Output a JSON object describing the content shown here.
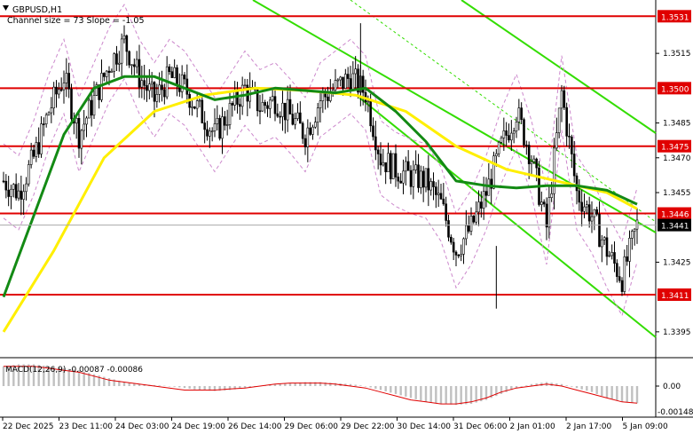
{
  "header": {
    "symbol": "GBPUSD,H1",
    "indicator": "Channel size = 73 Slope = -1.05"
  },
  "macd": {
    "label": "MACD(12,26,9) -0.00087 -0.00086",
    "zero_label": "0.00",
    "min_label": "-0.00148"
  },
  "chart_data": [
    {
      "type": "candlestick",
      "title": "GBPUSD,H1",
      "ylim": [
        1.3385,
        1.3538
      ],
      "y_ticks": [
        "1.3515",
        "1.3485",
        "1.3470",
        "1.3455",
        "1.3425",
        "1.3395"
      ],
      "x_ticks": [
        "22 Dec 2025",
        "23 Dec 11:00",
        "24 Dec 03:00",
        "24 Dec 19:00",
        "26 Dec 14:00",
        "29 Dec 06:00",
        "29 Dec 22:00",
        "30 Dec 14:00",
        "31 Dec 06:00",
        "2 Jan 01:00",
        "2 Jan 17:00",
        "5 Jan 09:00"
      ],
      "levels": [
        {
          "label": "1.3531",
          "value": 1.3531,
          "color": "#e00000"
        },
        {
          "label": "1.3500",
          "value": 1.35,
          "color": "#e00000"
        },
        {
          "label": "1.3475",
          "value": 1.3475,
          "color": "#e00000"
        },
        {
          "label": "1.3446",
          "value": 1.3446,
          "color": "#e00000"
        },
        {
          "label": "1.3411",
          "value": 1.3411,
          "color": "#e00000"
        }
      ],
      "current_price": "1.3441",
      "close_path": [
        [
          0,
          1.346
        ],
        [
          6,
          1.3455
        ],
        [
          12,
          1.347
        ],
        [
          18,
          1.349
        ],
        [
          24,
          1.3505
        ],
        [
          30,
          1.348
        ],
        [
          36,
          1.3495
        ],
        [
          42,
          1.351
        ],
        [
          48,
          1.352
        ],
        [
          54,
          1.3505
        ],
        [
          60,
          1.3495
        ],
        [
          66,
          1.3505
        ],
        [
          72,
          1.35
        ],
        [
          78,
          1.349
        ],
        [
          84,
          1.348
        ],
        [
          90,
          1.349
        ],
        [
          96,
          1.35
        ],
        [
          102,
          1.3492
        ],
        [
          108,
          1.3495
        ],
        [
          114,
          1.3488
        ],
        [
          120,
          1.348
        ],
        [
          126,
          1.3495
        ],
        [
          132,
          1.35
        ],
        [
          138,
          1.3505
        ],
        [
          144,
          1.3498
        ],
        [
          150,
          1.347
        ],
        [
          156,
          1.3465
        ],
        [
          162,
          1.3462
        ],
        [
          168,
          1.346
        ],
        [
          174,
          1.345
        ],
        [
          180,
          1.343
        ],
        [
          186,
          1.344
        ],
        [
          192,
          1.3455
        ],
        [
          198,
          1.3475
        ],
        [
          204,
          1.349
        ],
        [
          210,
          1.347
        ],
        [
          216,
          1.344
        ],
        [
          222,
          1.3498
        ],
        [
          228,
          1.3455
        ],
        [
          234,
          1.3445
        ],
        [
          240,
          1.343
        ],
        [
          246,
          1.3418
        ],
        [
          252,
          1.3441
        ]
      ],
      "series": [
        {
          "name": "",
          "color": "#ffef00",
          "values": [
            [
              0,
              1.3395
            ],
            [
              20,
              1.343
            ],
            [
              40,
              1.347
            ],
            [
              60,
              1.349
            ],
            [
              80,
              1.3497
            ],
            [
              100,
              1.35
            ],
            [
              120,
              1.3499
            ],
            [
              140,
              1.3497
            ],
            [
              160,
              1.349
            ],
            [
              180,
              1.3475
            ],
            [
              200,
              1.3465
            ],
            [
              220,
              1.346
            ],
            [
              240,
              1.3455
            ],
            [
              252,
              1.3448
            ]
          ]
        },
        {
          "name": "",
          "color": "#138a14",
          "values": [
            [
              0,
              1.341
            ],
            [
              12,
              1.3445
            ],
            [
              24,
              1.348
            ],
            [
              36,
              1.35
            ],
            [
              48,
              1.3505
            ],
            [
              60,
              1.3505
            ],
            [
              72,
              1.35
            ],
            [
              84,
              1.3495
            ],
            [
              96,
              1.3497
            ],
            [
              108,
              1.35
            ],
            [
              120,
              1.3499
            ],
            [
              132,
              1.3498
            ],
            [
              144,
              1.35
            ],
            [
              156,
              1.349
            ],
            [
              168,
              1.3477
            ],
            [
              180,
              1.346
            ],
            [
              192,
              1.3458
            ],
            [
              204,
              1.3457
            ],
            [
              216,
              1.3458
            ],
            [
              228,
              1.3458
            ],
            [
              240,
              1.3456
            ],
            [
              252,
              1.345
            ]
          ]
        }
      ],
      "macd_hist": [
        0.001,
        0.0011,
        0.0011,
        0.001,
        0.0009,
        0.0008,
        0.0006,
        0.0004,
        0.0002,
        0.0001,
        5e-05,
        0.0,
        -0.0001,
        -0.0002,
        -0.00025,
        -0.0002,
        -0.0001,
        0.0,
        0.0001,
        0.00015,
        0.0002,
        0.0002,
        0.00015,
        0.0001,
        0.0,
        -0.0002,
        -0.0004,
        -0.0006,
        -0.0008,
        -0.0009,
        -0.00095,
        -0.0009,
        -0.0007,
        -0.0004,
        -0.0001,
        0.0001,
        0.0002,
        0.0001,
        -0.0001,
        -0.0003,
        -0.0006,
        -0.0008,
        -0.00087
      ],
      "macd_signal": [
        0.001,
        0.001,
        0.001,
        0.0009,
        0.0008,
        0.0007,
        0.0005,
        0.0003,
        0.0002,
        0.0001,
        0.0,
        -0.0001,
        -0.0002,
        -0.0002,
        -0.0002,
        -0.00015,
        -0.0001,
        0.0,
        0.0001,
        0.00015,
        0.00015,
        0.00015,
        0.0001,
        0.0,
        -0.0001,
        -0.0003,
        -0.0005,
        -0.0007,
        -0.0008,
        -0.0009,
        -0.0009,
        -0.0008,
        -0.0006,
        -0.0003,
        -0.0001,
        0.0,
        0.0001,
        0.0,
        -0.0002,
        -0.0004,
        -0.0006,
        -0.0008,
        -0.00086
      ],
      "macd_ylim": [
        -0.00148,
        0.0013
      ]
    }
  ],
  "colors": {
    "level": "#e00000",
    "candle": "#000000",
    "channel": "#33dd00",
    "envelope": "#cc88cc",
    "macd_hist": "#c0c0c0",
    "macd_signal": "#e00000",
    "price_tag_bg": "#000000",
    "level_tag_bg": "#e00000"
  }
}
